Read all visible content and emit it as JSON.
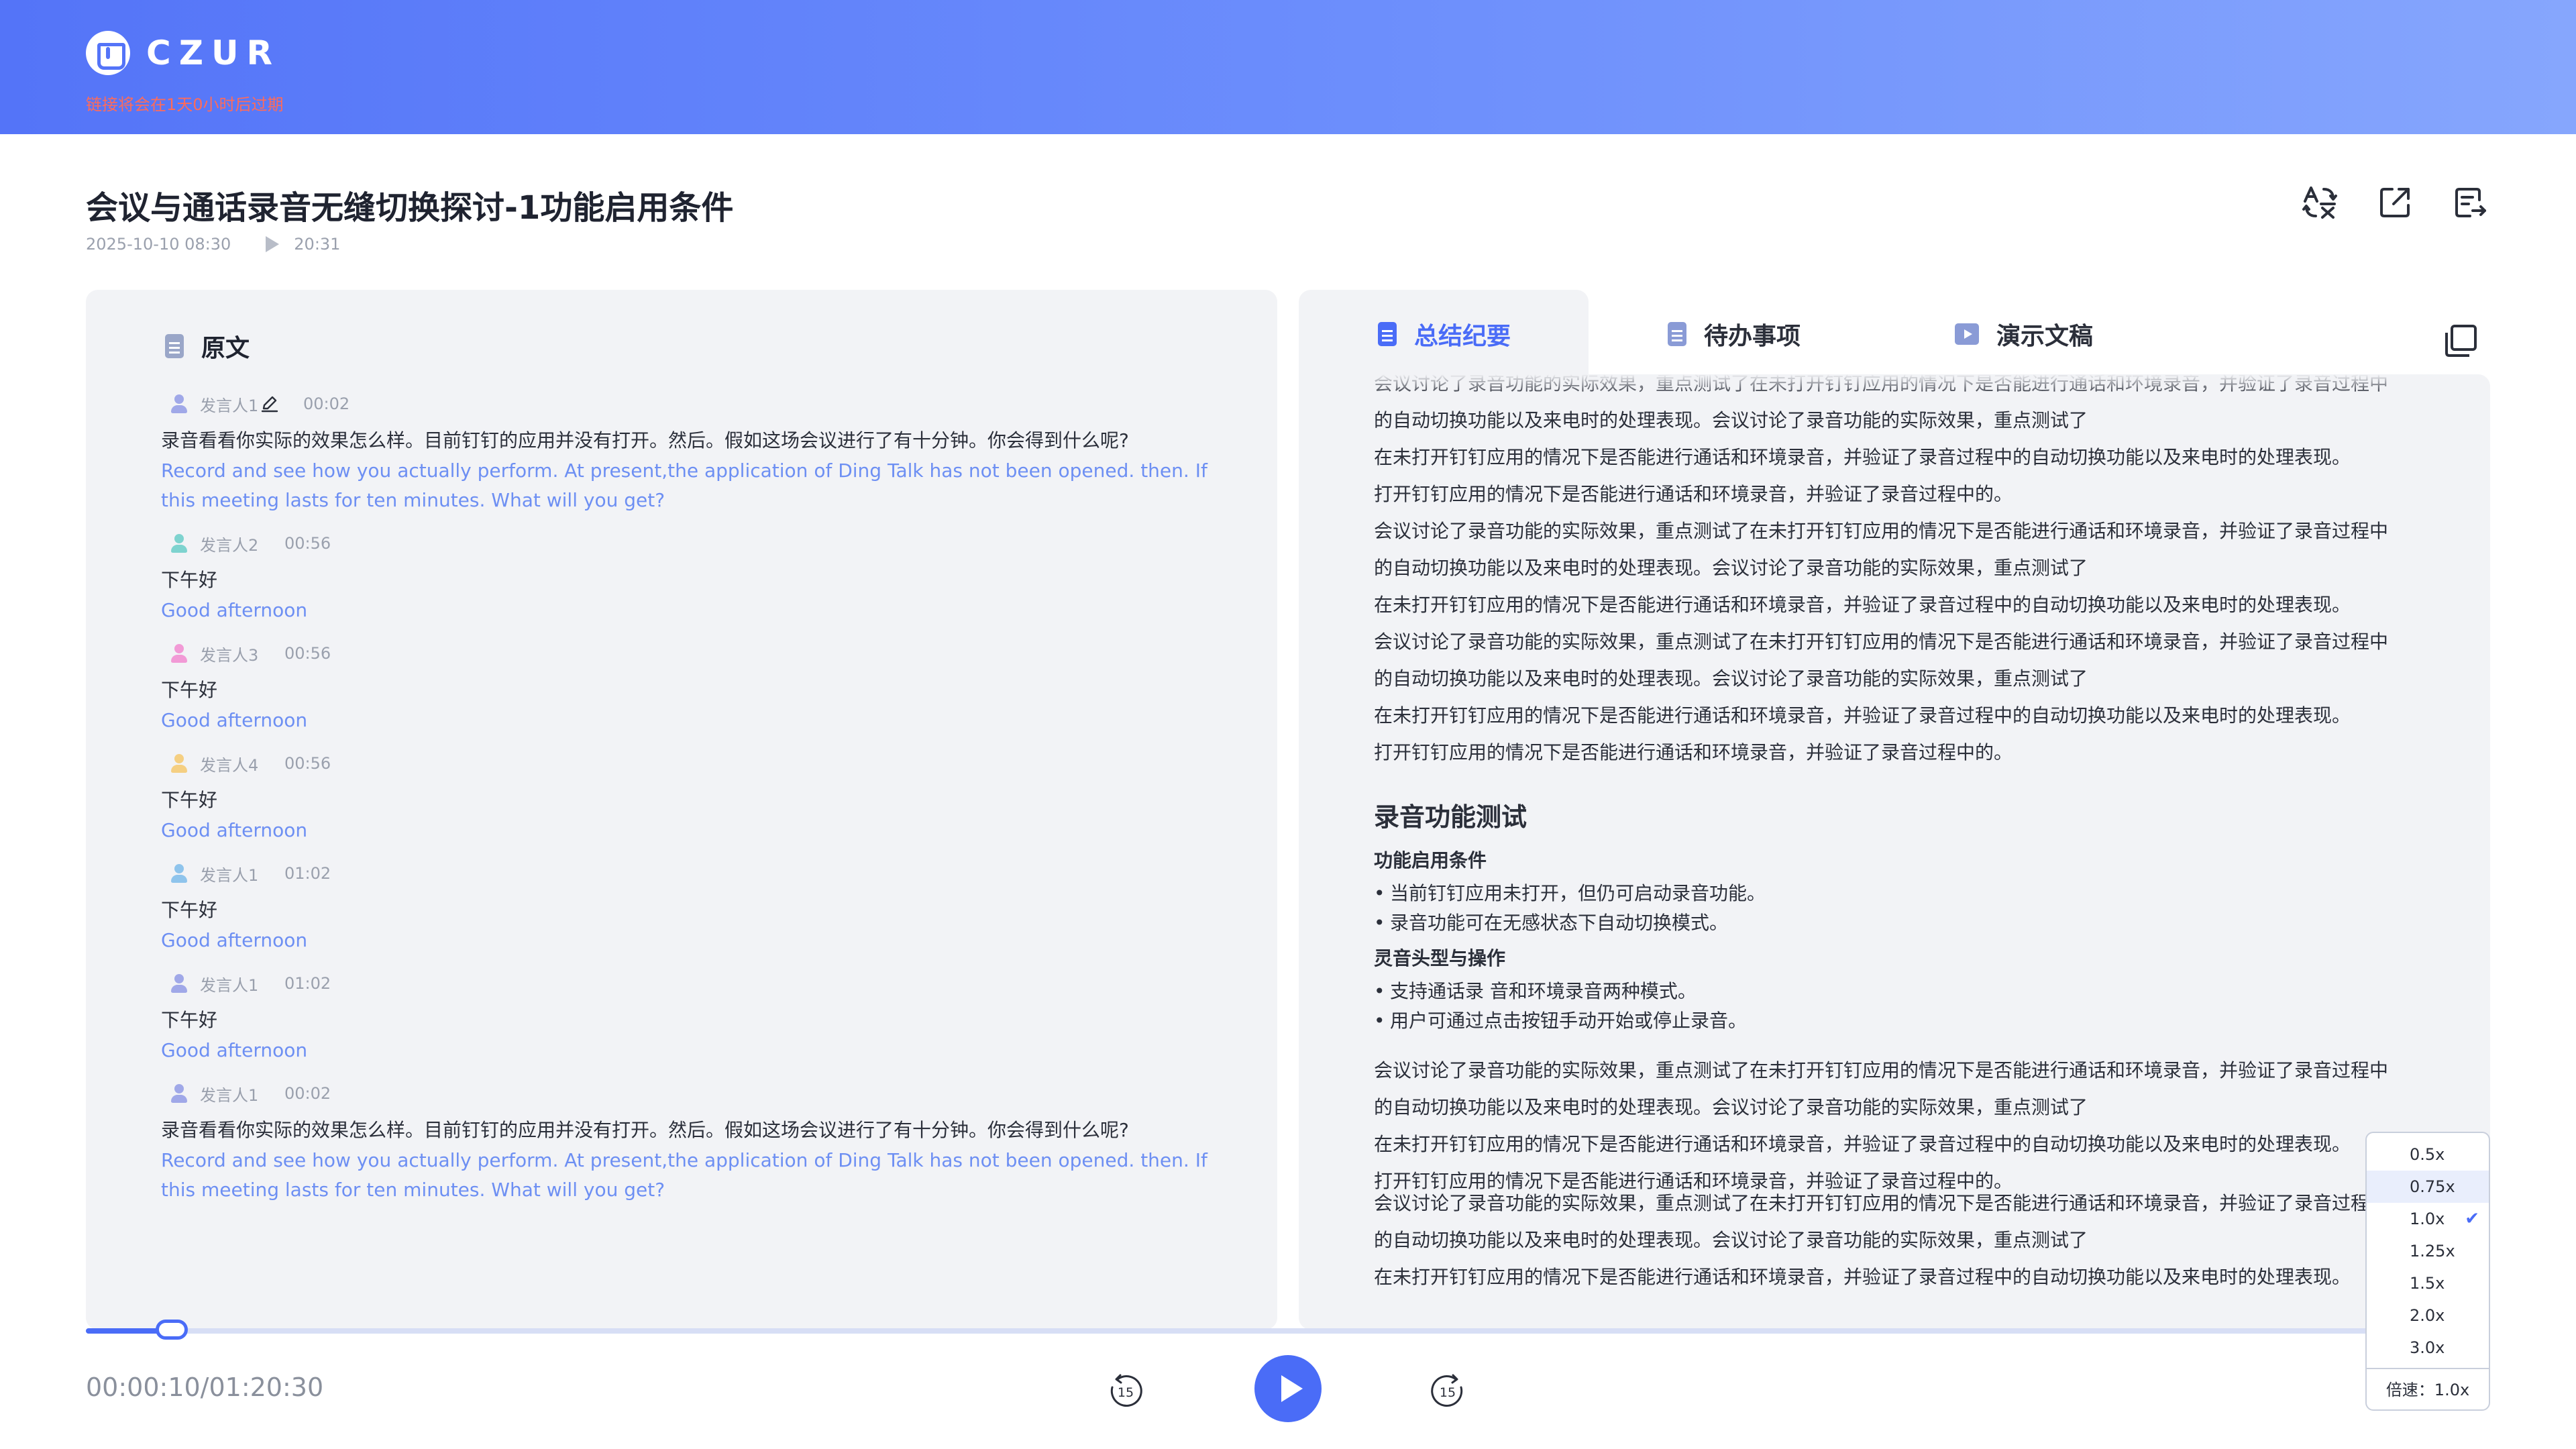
{
  "brand": {
    "name": "CZUR",
    "expire_notice": "链接将会在1天0小时后过期"
  },
  "recording": {
    "title": "会议与通话录音无缝切换探讨-1功能启用条件",
    "datetime": "2025-10-10  08:30",
    "duration": "20:31"
  },
  "transcript": {
    "title": "原文",
    "entries": [
      {
        "speaker": "发言人1",
        "time": "00:02",
        "color": "#a0a8e8",
        "cn": "录音看看你实际的效果怎么样。目前钉钉的应用并没有打开。然后。假如这场会议进行了有十分钟。你会得到什么呢?",
        "en": "Record and see how you actually perform. At present,the application of Ding Talk has not been opened. then. If this meeting lasts for ten minutes. What will you get?"
      },
      {
        "speaker": "发言人2",
        "time": "00:56",
        "color": "#7ed3cf",
        "cn": "下午好",
        "en": "Good afternoon"
      },
      {
        "speaker": "发言人3",
        "time": "00:56",
        "color": "#f29ad6",
        "cn": "下午好",
        "en": "Good afternoon"
      },
      {
        "speaker": "发言人4",
        "time": "00:56",
        "color": "#f5cf82",
        "cn": "下午好",
        "en": "Good afternoon"
      },
      {
        "speaker": "发言人1",
        "time": "01:02",
        "color": "#8fc4ec",
        "cn": "下午好",
        "en": "Good afternoon"
      },
      {
        "speaker": "发言人1",
        "time": "01:02",
        "color": "#a0a8e8",
        "cn": "下午好",
        "en": "Good afternoon"
      },
      {
        "speaker": "发言人1",
        "time": "00:02",
        "color": "#a0a8e8",
        "cn": "录音看看你实际的效果怎么样。目前钉钉的应用并没有打开。然后。假如这场会议进行了有十分钟。你会得到什么呢?",
        "en": "Record and see how you actually perform. At present,the application of Ding Talk has not been opened. then. If this meeting lasts for ten minutes. What will you get?"
      }
    ]
  },
  "tabs": {
    "summary": "总结纪要",
    "todo": "待办事项",
    "slides": "演示文稿"
  },
  "summary": {
    "block1": [
      "会议讨论了录音功能的实际效果，重点测试了在未打开钉钉应用的情况下是否能进行通话和环境录音，并验证了录音过程中",
      "的自动切换功能以及来电时的处理表现。会议讨论了录音功能的实际效果，重点测试了",
      "在未打开钉钉应用的情况下是否能进行通话和环境录音，并验证了录音过程中的自动切换功能以及来电时的处理表现。",
      "打开钉钉应用的情况下是否能进行通话和环境录音，并验证了录音过程中的。",
      "会议讨论了录音功能的实际效果，重点测试了在未打开钉钉应用的情况下是否能进行通话和环境录音，并验证了录音过程中",
      "的自动切换功能以及来电时的处理表现。会议讨论了录音功能的实际效果，重点测试了",
      "在未打开钉钉应用的情况下是否能进行通话和环境录音，并验证了录音过程中的自动切换功能以及来电时的处理表现。",
      "会议讨论了录音功能的实际效果，重点测试了在未打开钉钉应用的情况下是否能进行通话和环境录音，并验证了录音过程中",
      "的自动切换功能以及来电时的处理表现。会议讨论了录音功能的实际效果，重点测试了",
      "在未打开钉钉应用的情况下是否能进行通话和环境录音，并验证了录音过程中的自动切换功能以及来电时的处理表现。",
      "打开钉钉应用的情况下是否能进行通话和环境录音，并验证了录音过程中的。"
    ],
    "heading": "录音功能测试",
    "sub1": "功能启用条件",
    "bullets1": [
      "当前钉钉应用未打开，但仍可启动录音功能。",
      "录音功能可在无感状态下自动切换模式。"
    ],
    "sub2": "灵音头型与操作",
    "bullets2": [
      "支持通话录 音和环境录音两种模式。",
      "用户可通过点击按钮手动开始或停止录音。"
    ],
    "block2": [
      "会议讨论了录音功能的实际效果，重点测试了在未打开钉钉应用的情况下是否能进行通话和环境录音，并验证了录音过程中",
      "的自动切换功能以及来电时的处理表现。会议讨论了录音功能的实际效果，重点测试了",
      "在未打开钉钉应用的情况下是否能进行通话和环境录音，并验证了录音过程中的自动切换功能以及来电时的处理表现。",
      "打开钉钉应用的情况下是否能进行通话和环境录音，并验证了录音过程中的。"
    ],
    "block3": [
      "会议讨论了录音功能的实际效果，重点测试了在未打开钉钉应用的情况下是否能进行通话和环境录音，并验证了录音过程中",
      "的自动切换功能以及来电时的处理表现。会议讨论了录音功能的实际效果，重点测试了",
      "在未打开钉钉应用的情况下是否能进行通话和环境录音，并验证了录音过程中的自动切换功能以及来电时的处理表现。"
    ]
  },
  "player": {
    "time_display": "00:00:10/01:20:30",
    "progress_fraction": 0.037,
    "rewind_label": "15",
    "forward_label": "15",
    "speed_options": [
      "0.5x",
      "0.75x",
      "1.0x",
      "1.25x",
      "1.5x",
      "2.0x",
      "3.0x"
    ],
    "highlighted_option": "0.75x",
    "selected_option": "1.0x",
    "speed_label": "倍速：1.0x"
  },
  "colors": {
    "accent": "#4a6cf7",
    "link": "#6d8ff3",
    "warning": "#ff6b5a",
    "panel": "#f2f3f6"
  },
  "icons": [
    "translate-icon",
    "share-icon",
    "export-icon",
    "copy-icon",
    "edit-pencil-icon",
    "rewind-15-icon",
    "forward-15-icon",
    "play-icon",
    "check-icon"
  ]
}
